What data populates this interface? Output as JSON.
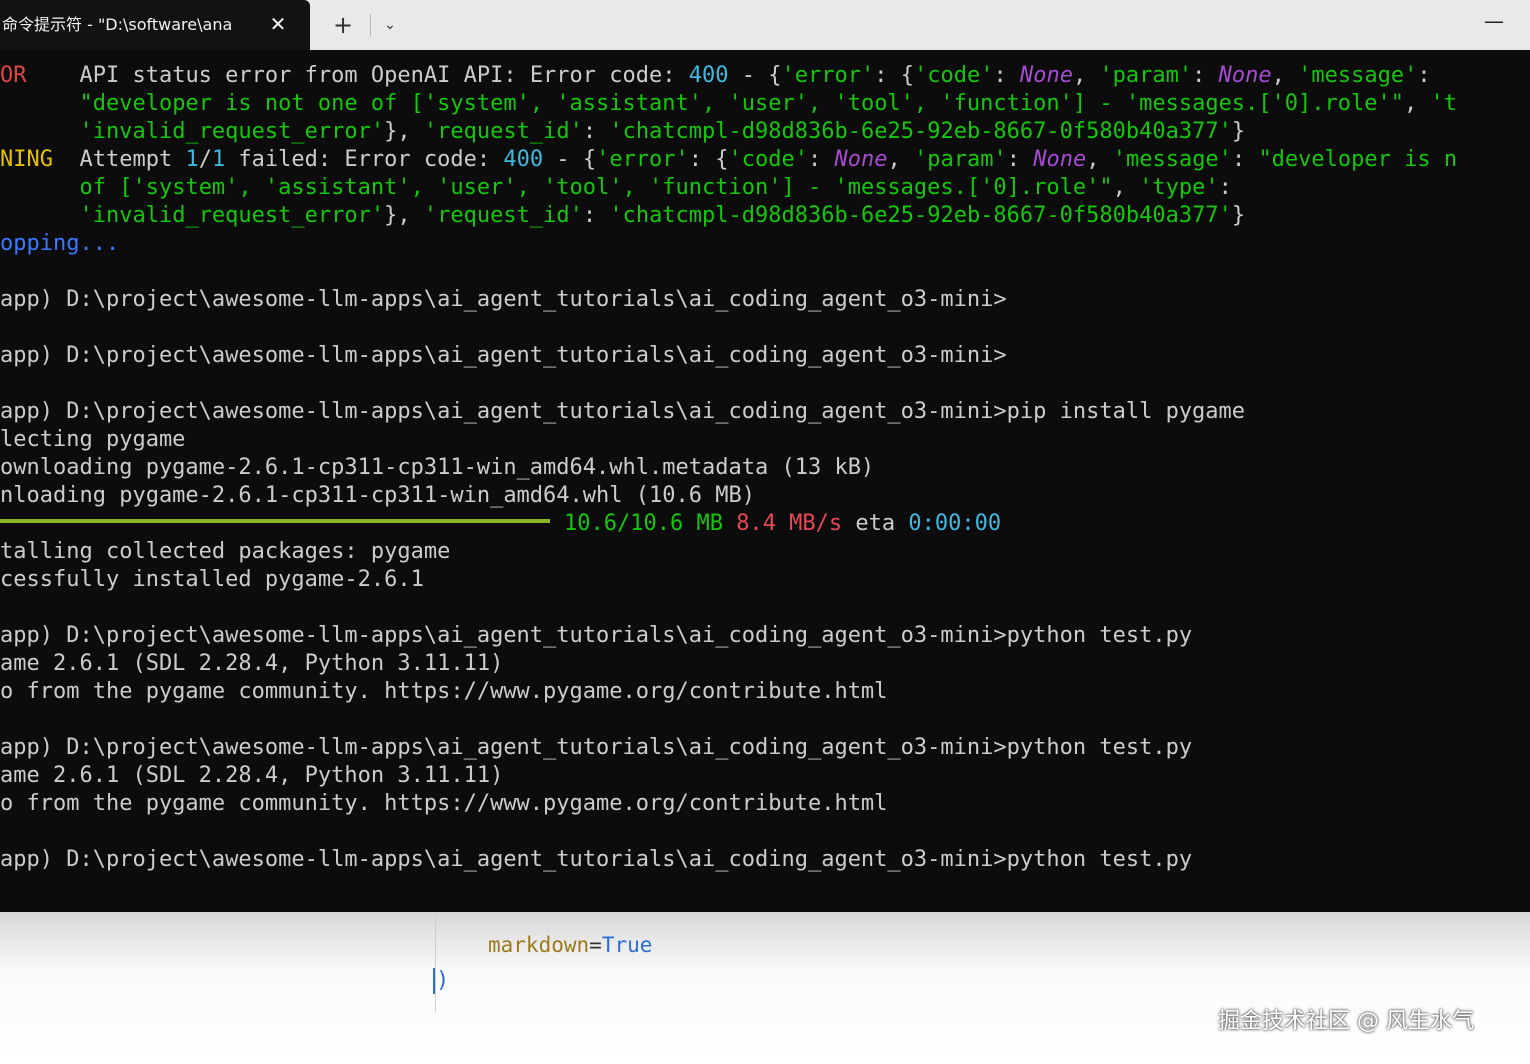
{
  "tab": {
    "title": "命令提示符 - \"D:\\software\\ana",
    "close_glyph": "✕"
  },
  "toolbar": {
    "new_tab_glyph": "+",
    "dropdown_glyph": "⌄",
    "minimize_glyph": "—"
  },
  "terminal": {
    "lines": [
      [
        {
          "t": "OR",
          "c": "c-red"
        },
        {
          "t": "    API status error from OpenAI API: Error code: ",
          "c": "c-white"
        },
        {
          "t": "400",
          "c": "c-cyan"
        },
        {
          "t": " - {",
          "c": "c-white"
        },
        {
          "t": "'error'",
          "c": "c-green"
        },
        {
          "t": ": {",
          "c": "c-white"
        },
        {
          "t": "'code'",
          "c": "c-green"
        },
        {
          "t": ": ",
          "c": "c-white"
        },
        {
          "t": "None",
          "c": "c-purple"
        },
        {
          "t": ", ",
          "c": "c-white"
        },
        {
          "t": "'param'",
          "c": "c-green"
        },
        {
          "t": ": ",
          "c": "c-white"
        },
        {
          "t": "None",
          "c": "c-purple"
        },
        {
          "t": ", ",
          "c": "c-white"
        },
        {
          "t": "'message'",
          "c": "c-green"
        },
        {
          "t": ":",
          "c": "c-white"
        }
      ],
      [
        {
          "t": "      ",
          "c": "c-white"
        },
        {
          "t": "\"developer is not one of ['system', 'assistant', 'user', 'tool', 'function'] - 'messages.['0].role'\"",
          "c": "c-green"
        },
        {
          "t": ", ",
          "c": "c-white"
        },
        {
          "t": "'t",
          "c": "c-green"
        }
      ],
      [
        {
          "t": "      ",
          "c": "c-white"
        },
        {
          "t": "'invalid_request_error'",
          "c": "c-green"
        },
        {
          "t": "}, ",
          "c": "c-white"
        },
        {
          "t": "'request_id'",
          "c": "c-green"
        },
        {
          "t": ": ",
          "c": "c-white"
        },
        {
          "t": "'chatcmpl-d98d836b-6e25-92eb-8667-0f580b40a377'",
          "c": "c-green"
        },
        {
          "t": "}",
          "c": "c-white"
        }
      ],
      [
        {
          "t": "NING",
          "c": "c-yellow"
        },
        {
          "t": "  Attempt ",
          "c": "c-white"
        },
        {
          "t": "1",
          "c": "c-cyan"
        },
        {
          "t": "/",
          "c": "c-white"
        },
        {
          "t": "1",
          "c": "c-cyan"
        },
        {
          "t": " failed: Error code: ",
          "c": "c-white"
        },
        {
          "t": "400",
          "c": "c-cyan"
        },
        {
          "t": " - {",
          "c": "c-white"
        },
        {
          "t": "'error'",
          "c": "c-green"
        },
        {
          "t": ": {",
          "c": "c-white"
        },
        {
          "t": "'code'",
          "c": "c-green"
        },
        {
          "t": ": ",
          "c": "c-white"
        },
        {
          "t": "None",
          "c": "c-purple"
        },
        {
          "t": ", ",
          "c": "c-white"
        },
        {
          "t": "'param'",
          "c": "c-green"
        },
        {
          "t": ": ",
          "c": "c-white"
        },
        {
          "t": "None",
          "c": "c-purple"
        },
        {
          "t": ", ",
          "c": "c-white"
        },
        {
          "t": "'message'",
          "c": "c-green"
        },
        {
          "t": ": ",
          "c": "c-white"
        },
        {
          "t": "\"developer is n",
          "c": "c-green"
        }
      ],
      [
        {
          "t": "      ",
          "c": "c-white"
        },
        {
          "t": "of ['system', 'assistant', 'user', 'tool', 'function'] - 'messages.['0].role'\"",
          "c": "c-green"
        },
        {
          "t": ", ",
          "c": "c-white"
        },
        {
          "t": "'type'",
          "c": "c-green"
        },
        {
          "t": ":",
          "c": "c-white"
        }
      ],
      [
        {
          "t": "      ",
          "c": "c-white"
        },
        {
          "t": "'invalid_request_error'",
          "c": "c-green"
        },
        {
          "t": "}, ",
          "c": "c-white"
        },
        {
          "t": "'request_id'",
          "c": "c-green"
        },
        {
          "t": ": ",
          "c": "c-white"
        },
        {
          "t": "'chatcmpl-d98d836b-6e25-92eb-8667-0f580b40a377'",
          "c": "c-green"
        },
        {
          "t": "}",
          "c": "c-white"
        }
      ],
      [
        {
          "t": "opping...",
          "c": "c-blue"
        }
      ],
      [],
      [
        {
          "t": "app) D:\\project\\awesome-llm-apps\\ai_agent_tutorials\\ai_coding_agent_o3-mini>",
          "c": "c-white"
        }
      ],
      [],
      [
        {
          "t": "app) D:\\project\\awesome-llm-apps\\ai_agent_tutorials\\ai_coding_agent_o3-mini>",
          "c": "c-white"
        }
      ],
      [],
      [
        {
          "t": "app) D:\\project\\awesome-llm-apps\\ai_agent_tutorials\\ai_coding_agent_o3-mini>pip install pygame",
          "c": "c-white"
        }
      ],
      [
        {
          "t": "lecting pygame",
          "c": "c-white"
        }
      ],
      [
        {
          "t": "ownloading pygame-2.6.1-cp311-cp311-win_amd64.whl.metadata (13 kB)",
          "c": "c-white"
        }
      ],
      [
        {
          "t": "nloading pygame-2.6.1-cp311-cp311-win_amd64.whl (10.6 MB)",
          "c": "c-white"
        }
      ],
      [
        {
          "bar": true
        },
        {
          "t": "10.6/10.6 MB",
          "c": "c-green"
        },
        {
          "t": " ",
          "c": "c-white"
        },
        {
          "t": "8.4 MB/s",
          "c": "c-brightred"
        },
        {
          "t": " eta ",
          "c": "c-white"
        },
        {
          "t": "0:00:00",
          "c": "c-cyan"
        }
      ],
      [
        {
          "t": "talling collected packages: pygame",
          "c": "c-white"
        }
      ],
      [
        {
          "t": "cessfully installed pygame-2.6.1",
          "c": "c-white"
        }
      ],
      [],
      [
        {
          "t": "app) D:\\project\\awesome-llm-apps\\ai_agent_tutorials\\ai_coding_agent_o3-mini>python test.py",
          "c": "c-white"
        }
      ],
      [
        {
          "t": "ame 2.6.1 (SDL 2.28.4, Python 3.11.11)",
          "c": "c-white"
        }
      ],
      [
        {
          "t": "o from the pygame community. https://www.pygame.org/contribute.html",
          "c": "c-white"
        }
      ],
      [],
      [
        {
          "t": "app) D:\\project\\awesome-llm-apps\\ai_agent_tutorials\\ai_coding_agent_o3-mini>python test.py",
          "c": "c-white"
        }
      ],
      [
        {
          "t": "ame 2.6.1 (SDL 2.28.4, Python 3.11.11)",
          "c": "c-white"
        }
      ],
      [
        {
          "t": "o from the pygame community. https://www.pygame.org/contribute.html",
          "c": "c-white"
        }
      ],
      [],
      [
        {
          "t": "app) D:\\project\\awesome-llm-apps\\ai_agent_tutorials\\ai_coding_agent_o3-mini>python test.py",
          "c": "c-white"
        }
      ]
    ],
    "progress": 1.0
  },
  "editor": {
    "param_name": "markdown",
    "equals": "=",
    "param_value": "True",
    "closing_paren": ")"
  },
  "watermark": "掘金技术社区 @ 风生水气"
}
